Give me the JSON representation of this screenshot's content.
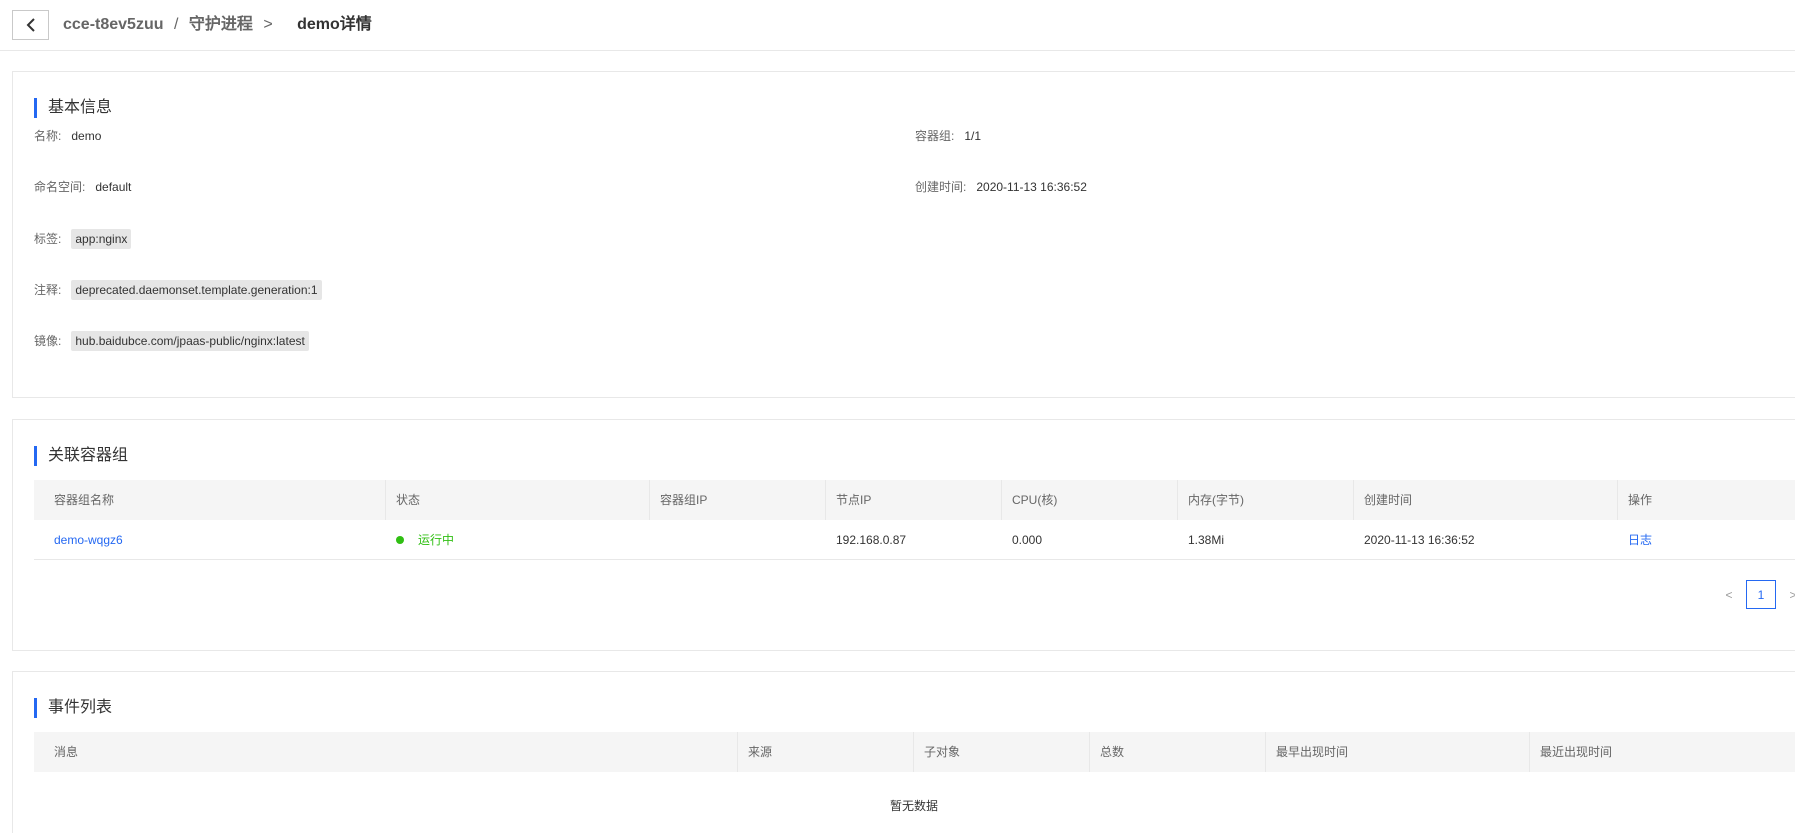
{
  "header": {
    "back_icon": "chevron-left-icon",
    "cluster": "cce-t8ev5zuu",
    "path_sep": "/",
    "section": "守护进程",
    "arrow": ">",
    "current": "demo详情"
  },
  "basic": {
    "title": "基本信息",
    "name_label": "名称:",
    "name_value": "demo",
    "pods_label": "容器组:",
    "pods_value": "1/1",
    "namespace_label": "命名空间:",
    "namespace_value": "default",
    "created_label": "创建时间:",
    "created_value": "2020-11-13 16:36:52",
    "labels_label": "标签:",
    "labels_value": "app:nginx",
    "annotations_label": "注释:",
    "annotations_value": "deprecated.daemonset.template.generation:1",
    "image_label": "镜像:",
    "image_value": "hub.baidubce.com/jpaas-public/nginx:latest"
  },
  "pods": {
    "title": "关联容器组",
    "columns": [
      "容器组名称",
      "状态",
      "容器组IP",
      "节点IP",
      "CPU(核)",
      "内存(字节)",
      "创建时间",
      "操作"
    ],
    "rows": [
      {
        "name": "demo-wqgz6",
        "status": "运行中",
        "pod_ip": "",
        "node_ip": "192.168.0.87",
        "cpu": "0.000",
        "memory": "1.38Mi",
        "created": "2020-11-13 16:36:52",
        "action": "日志"
      }
    ],
    "status_color": "#30bf13",
    "pagination": {
      "prev": "<",
      "current": "1",
      "next": ">"
    }
  },
  "events": {
    "title": "事件列表",
    "columns": [
      "消息",
      "来源",
      "子对象",
      "总数",
      "最早出现时间",
      "最近出现时间"
    ],
    "empty_text": "暂无数据"
  },
  "colors": {
    "accent": "#2468f2",
    "success": "#30bf13",
    "table_header_bg": "#f5f5f5",
    "tag_bg": "#e6e6e6"
  }
}
